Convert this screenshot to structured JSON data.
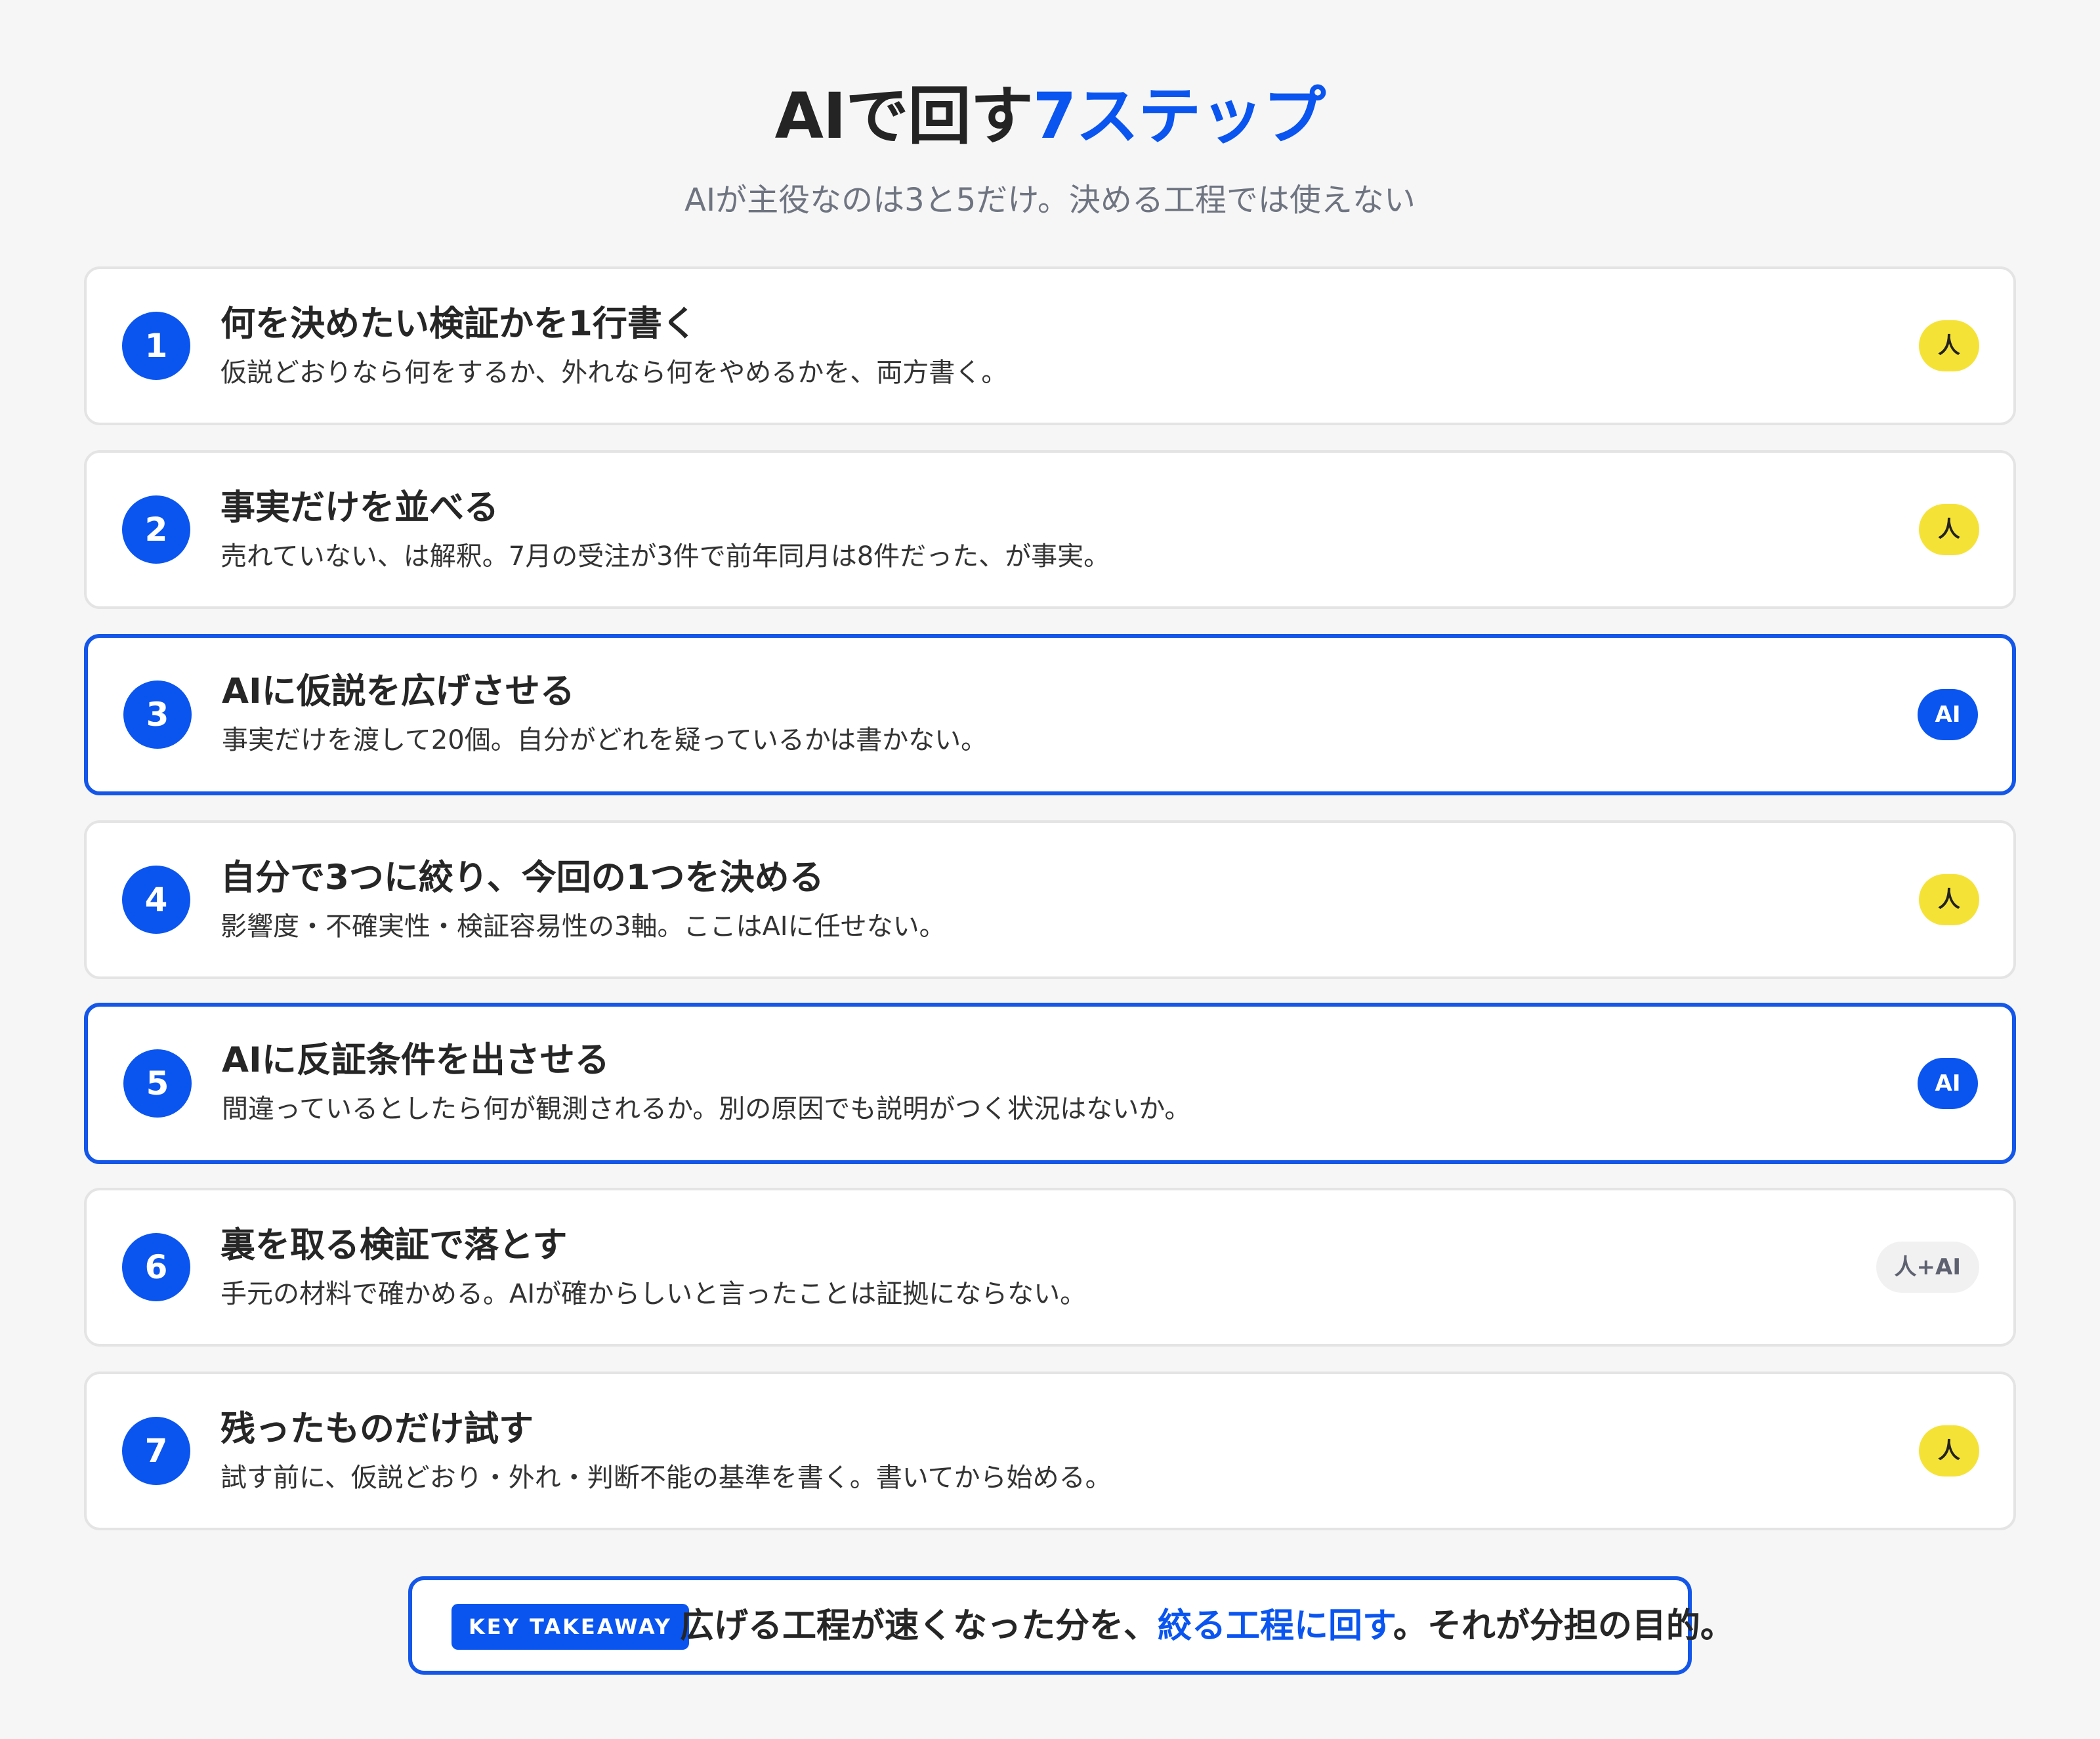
{
  "header": {
    "title_prefix": "AIで回す",
    "title_accent": "7ステップ",
    "subtitle": "AIが主役なのは3と5だけ。決める工程では使えない"
  },
  "steps": [
    {
      "number": "1",
      "title": "何を決めたい検証かを1行書く",
      "description": "仮説どおりなら何をするか、外れなら何をやめるかを、両方書く。",
      "badge": "人",
      "badge_type": "human"
    },
    {
      "number": "2",
      "title": "事実だけを並べる",
      "description": "売れていない、は解釈。7月の受注が3件で前年同月は8件だった、が事実。",
      "badge": "人",
      "badge_type": "human"
    },
    {
      "number": "3",
      "title": "AIに仮説を広げさせる",
      "description": "事実だけを渡して20個。自分がどれを疑っているかは書かない。",
      "badge": "AI",
      "badge_type": "ai"
    },
    {
      "number": "4",
      "title": "自分で3つに絞り、今回の1つを決める",
      "description": "影響度・不確実性・検証容易性の3軸。ここはAIに任せない。",
      "badge": "人",
      "badge_type": "human"
    },
    {
      "number": "5",
      "title": "AIに反証条件を出させる",
      "description": "間違っているとしたら何が観測されるか。別の原因でも説明がつく状況はないか。",
      "badge": "AI",
      "badge_type": "ai"
    },
    {
      "number": "6",
      "title": "裏を取る検証で落とす",
      "description": "手元の材料で確かめる。AIが確からしいと言ったことは証拠にならない。",
      "badge": "人+AI",
      "badge_type": "both"
    },
    {
      "number": "7",
      "title": "残ったものだけ試す",
      "description": "試す前に、仮説どおり・外れ・判断不能の基準を書く。書いてから始める。",
      "badge": "人",
      "badge_type": "human"
    }
  ],
  "takeaway": {
    "tag": "KEY TAKEAWAY",
    "text_before": "広げる工程が速くなった分を、",
    "text_highlight": "絞る工程に回す",
    "text_after": "。それが分担の目的。"
  },
  "colors": {
    "accent": "#0a55f0",
    "human_badge": "#f5e237",
    "ai_border": "#1457e8",
    "background": "#f6f6f6"
  }
}
